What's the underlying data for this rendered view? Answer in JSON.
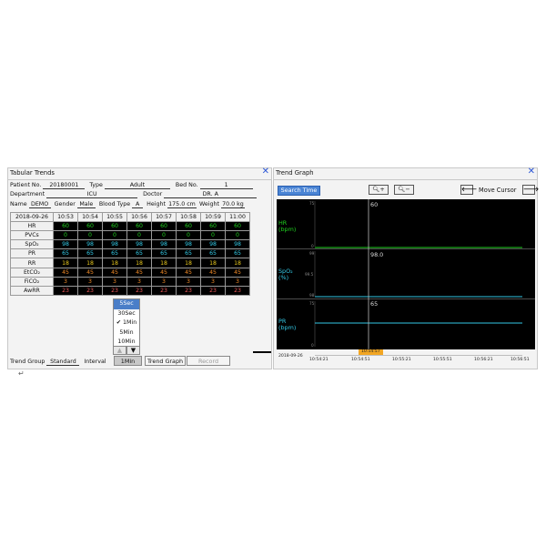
{
  "tabular": {
    "title": "Tabular Trends",
    "patient_no_label": "Patient No.",
    "patient_no": "20180001",
    "type_label": "Type",
    "type": "Adult",
    "bed_no_label": "Bed No.",
    "bed_no": "1",
    "department_label": "Department",
    "department": "ICU",
    "doctor_label": "Doctor",
    "doctor": "DR. A",
    "name_label": "Name",
    "name": "DEMO",
    "gender_label": "Gender",
    "gender": "Male",
    "blood_type_label": "Blood Type",
    "blood_type": "A",
    "height_label": "Height",
    "height": "175.0 cm",
    "weight_label": "Weight",
    "weight": "70.0 kg",
    "date": "2018-09-26",
    "times": [
      "10:53",
      "10:54",
      "10:55",
      "10:56",
      "10:57",
      "10:58",
      "10:59",
      "11:00"
    ],
    "params": [
      {
        "label": "HR",
        "value": "60",
        "color": "#1fd11f"
      },
      {
        "label": "PVCs",
        "value": "0",
        "color": "#1fd11f"
      },
      {
        "label": "SpO₂",
        "value": "98",
        "color": "#33c9e6"
      },
      {
        "label": "PR",
        "value": "65",
        "color": "#33c9e6"
      },
      {
        "label": "RR",
        "value": "18",
        "color": "#e8c81e"
      },
      {
        "label": "EtCO₂",
        "value": "45",
        "color": "#f08a28"
      },
      {
        "label": "FiCO₂",
        "value": "3",
        "color": "#f08a28"
      },
      {
        "label": "AwRR",
        "value": "23",
        "color": "#f05a5a"
      }
    ],
    "interval_options": [
      "5Sec",
      "30Sec",
      "1Min",
      "5Min",
      "10Min"
    ],
    "interval_checked": "1Min",
    "trend_group_label": "Trend Group",
    "trend_group": "Standard",
    "interval_label": "Interval",
    "interval_value": "1Min",
    "trend_graph_button": "Trend Graph",
    "record_button": "Record"
  },
  "graph": {
    "title": "Trend Graph",
    "search_time_button": "Search Time",
    "move_cursor_label": "Move Cursor",
    "hr_label": "HR",
    "hr_unit": "(bpm)",
    "hr_cursor_value": "60",
    "spo2_label": "SpO₂",
    "spo2_unit": "(%)",
    "spo2_cursor_value": "98.0",
    "pr_label": "PR",
    "pr_unit": "(bpm)",
    "pr_cursor_value": "65",
    "hr_ticks": [
      "75",
      "",
      "0"
    ],
    "spo2_ticks": [
      "99",
      "99.5",
      "98"
    ],
    "pr_ticks": [
      "75",
      "",
      "0"
    ],
    "cursor_time": "10:54:57",
    "date": "2018-09-26",
    "x_ticks": [
      "10:54:21",
      "10:54:51",
      "10:55:21",
      "10:55:51",
      "10:56:21",
      "10:56:51"
    ],
    "colors": {
      "hr": "#1fd11f",
      "spo2": "#33c9e6",
      "pr": "#33c9e6",
      "cursor_time_bg": "#f2a623"
    }
  },
  "bottom_glyph": "↵"
}
